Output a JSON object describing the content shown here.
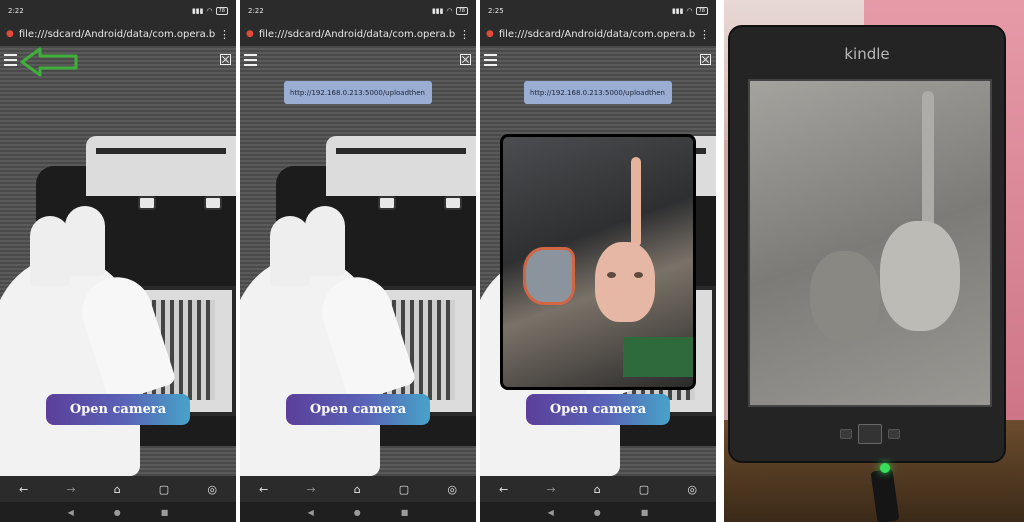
{
  "screens": [
    {
      "status_time": "2:22",
      "battery": "78",
      "url": "file:///sdcard/Android/data/com.opera.brow",
      "show_url_input": false,
      "show_photo": false,
      "show_arrow": true,
      "camera_button": "Open camera"
    },
    {
      "status_time": "2:22",
      "battery": "78",
      "url": "file:///sdcard/Android/data/com.opera.brow",
      "show_url_input": true,
      "url_input_value": "http://192.168.0.213:5000/uploadthen",
      "show_photo": false,
      "show_arrow": false,
      "camera_button": "Open camera"
    },
    {
      "status_time": "2:25",
      "battery": "78",
      "url": "file:///sdcard/Android/data/com.opera.brow",
      "show_url_input": true,
      "url_input_value": "http://192.168.0.213:5000/uploadthen",
      "show_photo": true,
      "show_arrow": false,
      "camera_button": "Open camera"
    }
  ],
  "kindle": {
    "logo": "kindle"
  },
  "colors": {
    "annotation_arrow": "#3fae3a",
    "button_gradient_start": "#5b3f9a",
    "button_gradient_end": "#46a3c8",
    "url_input_bg": "#9aaed4",
    "led": "#36e05c"
  }
}
